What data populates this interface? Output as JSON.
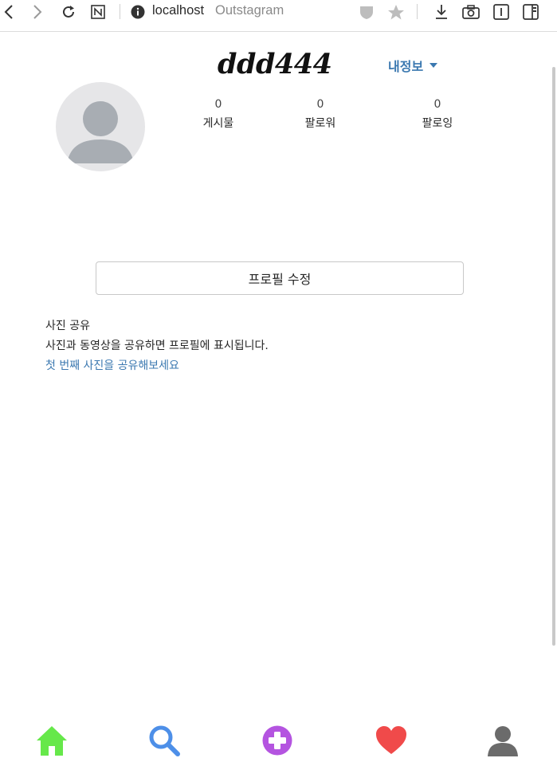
{
  "browser": {
    "host": "localhost",
    "page_title": "Outstagram",
    "icons": [
      "back-icon",
      "forward-icon",
      "reload-icon",
      "notion-icon",
      "info-icon",
      "shield-icon",
      "star-icon",
      "download-icon",
      "camera-icon",
      "reader-icon",
      "sidebar-icon"
    ]
  },
  "profile": {
    "username": "ddd444",
    "menu_label": "내정보",
    "stats": [
      {
        "value": "0",
        "label": "게시물"
      },
      {
        "value": "0",
        "label": "팔로워"
      },
      {
        "value": "0",
        "label": "팔로잉"
      }
    ],
    "edit_button_label": "프로필 수정"
  },
  "share": {
    "title": "사진 공유",
    "description": "사진과 동영상을 공유하면 프로필에 표시됩니다.",
    "link": "첫 번째 사진을 공유해보세요"
  },
  "bottom_nav": {
    "items": [
      {
        "icon": "home-icon",
        "color": "#66e84a"
      },
      {
        "icon": "search-icon",
        "color": "#4d8fe8"
      },
      {
        "icon": "add-icon",
        "color": "#b454e0"
      },
      {
        "icon": "heart-icon",
        "color": "#f04a4a"
      },
      {
        "icon": "user-icon",
        "color": "#6b6b6b"
      }
    ]
  }
}
